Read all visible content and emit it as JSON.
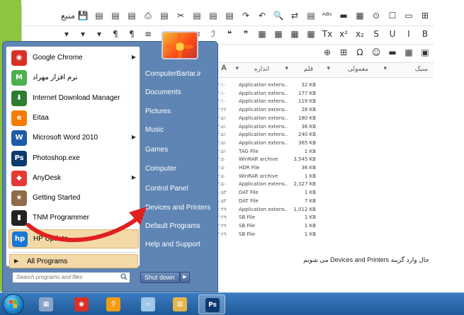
{
  "editor": {
    "toolbar_glyphs_row1": [
      "⊞",
      "▭",
      "☐",
      "⊙",
      "▦",
      "▬",
      "ᴬᴮᶜ",
      "▤",
      "⇄",
      "🔍",
      "↶",
      "↷",
      "▤",
      "▤",
      "▤",
      "✂",
      "▤",
      "⎙",
      "▤",
      "▤",
      "▤",
      "💾",
      "منبع"
    ],
    "toolbar_glyphs_row2": [
      "B",
      "I",
      "U",
      "S",
      "x₂",
      "x²",
      "Tx",
      "▦",
      "▦",
      "▦",
      "▦",
      "❞",
      "❝",
      "ℐ",
      "≡",
      "≡",
      "≡",
      "≡",
      "¶",
      "¶",
      "▾",
      "▾",
      "▾"
    ],
    "toolbar_glyphs_row3": [
      "▣",
      "▦",
      "▬",
      "☺",
      "Ω",
      "⊞",
      "⊕"
    ],
    "font_row": {
      "style_label": "سبک",
      "format_label": "معمولی",
      "font_label": "قلم",
      "size_label": "اندازه",
      "color_label": "A"
    },
    "files": [
      {
        "date": "۲:۱۰",
        "type": "Application extens...",
        "size": "32 KB"
      },
      {
        "date": "۲:۱۰",
        "type": "Application extens...",
        "size": "177 KB"
      },
      {
        "date": "۲:۱۰",
        "type": "Application extens...",
        "size": "119 KB"
      },
      {
        "date": "۲:۲۲",
        "type": "Application extens...",
        "size": "28 KB"
      },
      {
        "date": "۲:۵۱",
        "type": "Application extens...",
        "size": "180 KB"
      },
      {
        "date": "۲:۵۱",
        "type": "Application extens...",
        "size": "36 KB"
      },
      {
        "date": "۲:۵۱",
        "type": "Application extens...",
        "size": "240 KB"
      },
      {
        "date": "۲:۵۱",
        "type": "Application extens...",
        "size": "365 KB"
      },
      {
        "date": "۲:۵۱",
        "type": "TAG File",
        "size": "1 KB"
      },
      {
        "date": "۲:۵۰",
        "type": "WinRAR archive",
        "size": "3,545 KB"
      },
      {
        "date": "۲:۵۰",
        "type": "HDR File",
        "size": "36 KB"
      },
      {
        "date": "۲:۵۰",
        "type": "WinRAR archive",
        "size": "1 KB"
      },
      {
        "date": "۲:۵۰",
        "type": "Application extens...",
        "size": "2,327 KB"
      },
      {
        "date": "۱:۵۳",
        "type": "DAT File",
        "size": "1 KB"
      },
      {
        "date": "۱:۵۳",
        "type": "DAT File",
        "size": "7 KB"
      },
      {
        "date": "۲:۴۹",
        "type": "Application extens...",
        "size": "1,012 KB"
      },
      {
        "date": "۲:۲۹",
        "type": "SB File",
        "size": "1 KB"
      },
      {
        "date": "۲:۲۹",
        "type": "SB File",
        "size": "1 KB"
      },
      {
        "date": "۲:۲۹",
        "type": "SB File",
        "size": "1 KB"
      }
    ],
    "article_text": "حال وارد گزینه Devices and Printers می شویم"
  },
  "start_menu": {
    "programs": [
      {
        "label": "Google Chrome",
        "icon": "chrome-icon",
        "glyph": "◉",
        "color": "#d93025",
        "has_arrow": true
      },
      {
        "label": "نرم افزار مهراد",
        "icon": "mehrad-icon",
        "glyph": "M",
        "color": "#4caf50",
        "has_arrow": false
      },
      {
        "label": "Internet Download Manager",
        "icon": "idm-icon",
        "glyph": "⬇",
        "color": "#2e7d32",
        "has_arrow": false
      },
      {
        "label": "Eitaa",
        "icon": "eitaa-icon",
        "glyph": "e",
        "color": "#f57c00",
        "has_arrow": false
      },
      {
        "label": "Microsoft Word 2010",
        "icon": "word-icon",
        "glyph": "W",
        "color": "#1e5aa8",
        "has_arrow": true
      },
      {
        "label": "Photoshop.exe",
        "icon": "photoshop-icon",
        "glyph": "Ps",
        "color": "#0b3a6e",
        "has_arrow": false
      },
      {
        "label": "AnyDesk",
        "icon": "anydesk-icon",
        "glyph": "◆",
        "color": "#e53935",
        "has_arrow": true
      },
      {
        "label": "Getting Started",
        "icon": "getting-started-icon",
        "glyph": "★",
        "color": "#8e6c4a",
        "has_arrow": false
      },
      {
        "label": "TNM Programmer",
        "icon": "tnm-icon",
        "glyph": "▮",
        "color": "#222222",
        "has_arrow": false
      },
      {
        "label": "HP Update",
        "icon": "hp-update-icon",
        "glyph": "hp",
        "color": "#1976d2",
        "has_arrow": false,
        "highlighted": true
      }
    ],
    "all_programs_label": "All Programs",
    "search_placeholder": "Search programs and files",
    "places": [
      "ComputerBartar.ir",
      "Documents",
      "Pictures",
      "Music",
      "Games",
      "Computer",
      "Control Panel",
      "Devices and Printers",
      "Default Programs",
      "Help and Support"
    ],
    "shutdown_label": "Shut down",
    "highlight_color": "#f3d9a8",
    "arrow_color": "#e02020"
  },
  "taskbar": {
    "items": [
      {
        "name": "start-orb",
        "glyph": ""
      },
      {
        "name": "calculator-icon",
        "glyph": "▦",
        "color": "#8aa4c8"
      },
      {
        "name": "chrome-taskbar-icon",
        "glyph": "◉",
        "color": "#d93025"
      },
      {
        "name": "search-app-icon",
        "glyph": "⚲",
        "color": "#f39c12"
      },
      {
        "name": "notepad-icon",
        "glyph": "▱",
        "color": "#9ec7e8"
      },
      {
        "name": "folder-icon",
        "glyph": "▥",
        "color": "#e6b54a"
      },
      {
        "name": "photoshop-taskbar-icon",
        "glyph": "Ps",
        "color": "#0b3a6e"
      }
    ]
  }
}
